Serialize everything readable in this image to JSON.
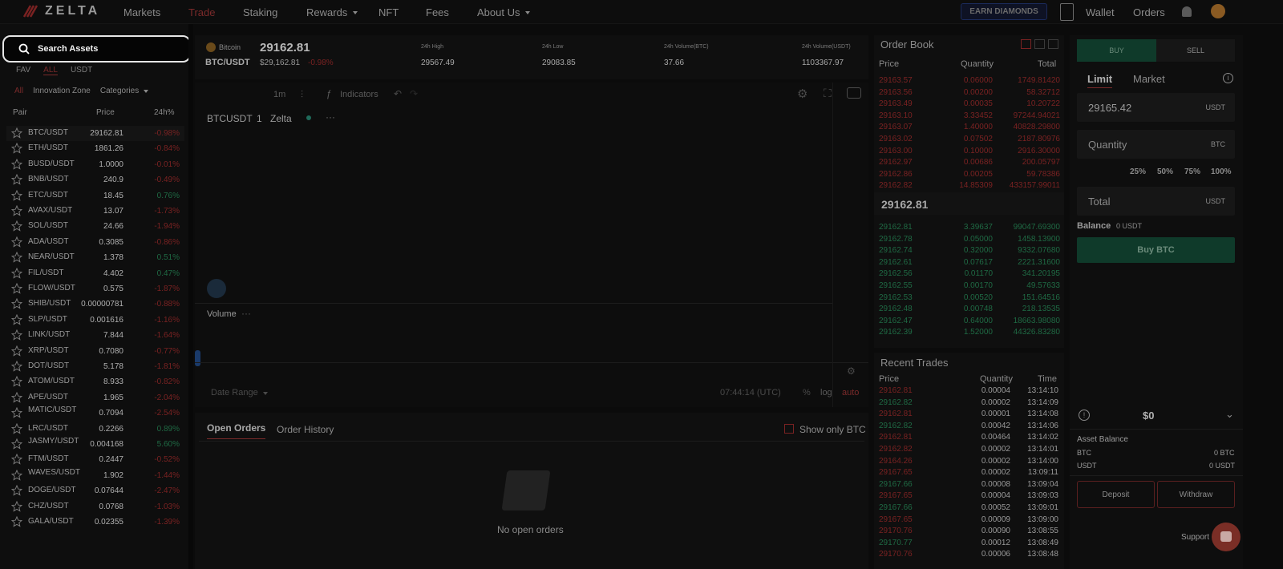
{
  "nav": {
    "logo_text": "ZELTA",
    "items": [
      "Markets",
      "Trade",
      "Staking",
      "Rewards",
      "NFT",
      "Fees",
      "About Us"
    ],
    "earn_button": "EARN DIAMONDS",
    "wallet": "Wallet",
    "orders": "Orders"
  },
  "sidebar": {
    "search_placeholder": "Search Assets",
    "tabs": [
      "FAV",
      "ALL",
      "USDT"
    ],
    "subtabs": [
      "All",
      "Innovation Zone",
      "Categories"
    ],
    "columns": [
      "Pair",
      "Price",
      "24h%"
    ],
    "pairs": [
      {
        "sym": "BTC/USDT",
        "price": "29162.81",
        "change": "-0.98%",
        "dir": "neg",
        "pcol": ""
      },
      {
        "sym": "ETH/USDT",
        "price": "1861.26",
        "change": "-0.84%",
        "dir": "neg",
        "pcol": "pos"
      },
      {
        "sym": "BUSD/USDT",
        "price": "1.0000",
        "change": "-0.01%",
        "dir": "neg",
        "pcol": ""
      },
      {
        "sym": "BNB/USDT",
        "price": "240.9",
        "change": "-0.49%",
        "dir": "neg",
        "pcol": ""
      },
      {
        "sym": "ETC/USDT",
        "price": "18.45",
        "change": "0.76%",
        "dir": "pos",
        "pcol": ""
      },
      {
        "sym": "AVAX/USDT",
        "price": "13.07",
        "change": "-1.73%",
        "dir": "neg",
        "pcol": ""
      },
      {
        "sym": "SOL/USDT",
        "price": "24.66",
        "change": "-1.94%",
        "dir": "neg",
        "pcol": ""
      },
      {
        "sym": "ADA/USDT",
        "price": "0.3085",
        "change": "-0.86%",
        "dir": "neg",
        "pcol": ""
      },
      {
        "sym": "NEAR/USDT",
        "price": "1.378",
        "change": "0.51%",
        "dir": "pos",
        "pcol": ""
      },
      {
        "sym": "FIL/USDT",
        "price": "4.402",
        "change": "0.47%",
        "dir": "pos",
        "pcol": ""
      },
      {
        "sym": "FLOW/USDT",
        "price": "0.575",
        "change": "-1.87%",
        "dir": "neg",
        "pcol": ""
      },
      {
        "sym": "SHIB/USDT",
        "price": "0.00000781",
        "change": "-0.88%",
        "dir": "neg",
        "pcol": "pos"
      },
      {
        "sym": "SLP/USDT",
        "price": "0.001616",
        "change": "-1.16%",
        "dir": "neg",
        "pcol": ""
      },
      {
        "sym": "LINK/USDT",
        "price": "7.844",
        "change": "-1.64%",
        "dir": "neg",
        "pcol": ""
      },
      {
        "sym": "XRP/USDT",
        "price": "0.7080",
        "change": "-0.77%",
        "dir": "neg",
        "pcol": ""
      },
      {
        "sym": "DOT/USDT",
        "price": "5.178",
        "change": "-1.81%",
        "dir": "neg",
        "pcol": ""
      },
      {
        "sym": "ATOM/USDT",
        "price": "8.933",
        "change": "-0.82%",
        "dir": "neg",
        "pcol": ""
      },
      {
        "sym": "APE/USDT",
        "price": "1.965",
        "change": "-2.04%",
        "dir": "neg",
        "pcol": ""
      },
      {
        "sym": "MATIC/USDT",
        "price": "0.7094",
        "change": "-2.54%",
        "dir": "neg",
        "pcol": ""
      },
      {
        "sym": "LRC/USDT",
        "price": "0.2266",
        "change": "0.89%",
        "dir": "pos",
        "pcol": ""
      },
      {
        "sym": "JASMY/USDT",
        "price": "0.004168",
        "change": "5.60%",
        "dir": "pos",
        "pcol": ""
      },
      {
        "sym": "FTM/USDT",
        "price": "0.2447",
        "change": "-0.52%",
        "dir": "neg",
        "pcol": ""
      },
      {
        "sym": "WAVES/USDT",
        "price": "1.902",
        "change": "-1.44%",
        "dir": "neg",
        "pcol": ""
      },
      {
        "sym": "DOGE/USDT",
        "price": "0.07644",
        "change": "-2.47%",
        "dir": "neg",
        "pcol": "neg"
      },
      {
        "sym": "CHZ/USDT",
        "price": "0.0768",
        "change": "-1.03%",
        "dir": "neg",
        "pcol": ""
      },
      {
        "sym": "GALA/USDT",
        "price": "0.02355",
        "change": "-1.39%",
        "dir": "neg",
        "pcol": ""
      }
    ]
  },
  "ticker": {
    "coin_name": "Bitcoin",
    "last_price": "29162.81",
    "pair": "BTC/USDT",
    "usd_price": "$29,162.81",
    "change": "-0.98%",
    "high_label": "24h High",
    "high": "29567.49",
    "low_label": "24h Low",
    "low": "29083.85",
    "vol_btc_label": "24h Volume(BTC)",
    "vol_btc": "37.66",
    "vol_usdt_label": "24h Volume(USDT)",
    "vol_usdt": "1103367.97"
  },
  "chart": {
    "interval": "1m",
    "indicators": "Indicators",
    "symbol": "BTCUSDT",
    "interval_num": "1",
    "source": "Zelta",
    "volume": "Volume",
    "date_range": "Date Range",
    "time": "07:44:14 (UTC)",
    "pct": "%",
    "log": "log",
    "auto": "auto"
  },
  "orders": {
    "tab_open": "Open Orders",
    "tab_history": "Order History",
    "show_only": "Show only BTC",
    "empty": "No open orders"
  },
  "orderbook": {
    "title": "Order Book",
    "cols": [
      "Price",
      "Quantity",
      "Total"
    ],
    "asks": [
      [
        "29163.57",
        "0.06000",
        "1749.81420"
      ],
      [
        "29163.56",
        "0.00200",
        "58.32712"
      ],
      [
        "29163.49",
        "0.00035",
        "10.20722"
      ],
      [
        "29163.10",
        "3.33452",
        "97244.94021"
      ],
      [
        "29163.07",
        "1.40000",
        "40828.29800"
      ],
      [
        "29163.02",
        "0.07502",
        "2187.80976"
      ],
      [
        "29163.00",
        "0.10000",
        "2916.30000"
      ],
      [
        "29162.97",
        "0.00686",
        "200.05797"
      ],
      [
        "29162.86",
        "0.00205",
        "59.78386"
      ],
      [
        "29162.82",
        "14.85309",
        "433157.99011"
      ]
    ],
    "mid": "29162.81",
    "bids": [
      [
        "29162.81",
        "3.39637",
        "99047.69300"
      ],
      [
        "29162.78",
        "0.05000",
        "1458.13900"
      ],
      [
        "29162.74",
        "0.32000",
        "9332.07680"
      ],
      [
        "29162.61",
        "0.07617",
        "2221.31600"
      ],
      [
        "29162.56",
        "0.01170",
        "341.20195"
      ],
      [
        "29162.55",
        "0.00170",
        "49.57633"
      ],
      [
        "29162.53",
        "0.00520",
        "151.64516"
      ],
      [
        "29162.48",
        "0.00748",
        "218.13535"
      ],
      [
        "29162.47",
        "0.64000",
        "18663.98080"
      ],
      [
        "29162.39",
        "1.52000",
        "44326.83280"
      ]
    ]
  },
  "recent": {
    "title": "Recent Trades",
    "cols": [
      "Price",
      "Quantity",
      "Time"
    ],
    "rows": [
      [
        "29162.81",
        "0.00004",
        "13:14:10",
        "neg"
      ],
      [
        "29162.82",
        "0.00002",
        "13:14:09",
        "pos"
      ],
      [
        "29162.81",
        "0.00001",
        "13:14:08",
        "neg"
      ],
      [
        "29162.82",
        "0.00042",
        "13:14:06",
        "pos"
      ],
      [
        "29162.81",
        "0.00464",
        "13:14:02",
        "neg"
      ],
      [
        "29162.82",
        "0.00002",
        "13:14:01",
        "neg"
      ],
      [
        "29164.26",
        "0.00002",
        "13:14:00",
        "neg"
      ],
      [
        "29167.65",
        "0.00002",
        "13:09:11",
        "neg"
      ],
      [
        "29167.66",
        "0.00008",
        "13:09:04",
        "pos"
      ],
      [
        "29167.65",
        "0.00004",
        "13:09:03",
        "neg"
      ],
      [
        "29167.66",
        "0.00052",
        "13:09:01",
        "pos"
      ],
      [
        "29167.65",
        "0.00009",
        "13:09:00",
        "neg"
      ],
      [
        "29170.76",
        "0.00090",
        "13:08:55",
        "neg"
      ],
      [
        "29170.77",
        "0.00012",
        "13:08:49",
        "pos"
      ],
      [
        "29170.76",
        "0.00006",
        "13:08:48",
        "neg"
      ]
    ]
  },
  "form": {
    "buy": "BUY",
    "sell": "SELL",
    "limit": "Limit",
    "market": "Market",
    "price": "29165.42",
    "price_unit": "USDT",
    "quantity": "Quantity",
    "quantity_unit": "BTC",
    "pcts": [
      "25%",
      "50%",
      "75%",
      "100%"
    ],
    "total": "Total",
    "total_unit": "USDT",
    "balance_label": "Balance",
    "balance_value": "0 USDT",
    "buy_btn": "Buy BTC",
    "dollar": "$0",
    "asset_balance": "Asset Balance",
    "btc_label": "BTC",
    "btc_value": "0 BTC",
    "usdt_label": "USDT",
    "usdt_value": "0 USDT",
    "deposit": "Deposit",
    "withdraw": "Withdraw",
    "support": "Support"
  }
}
